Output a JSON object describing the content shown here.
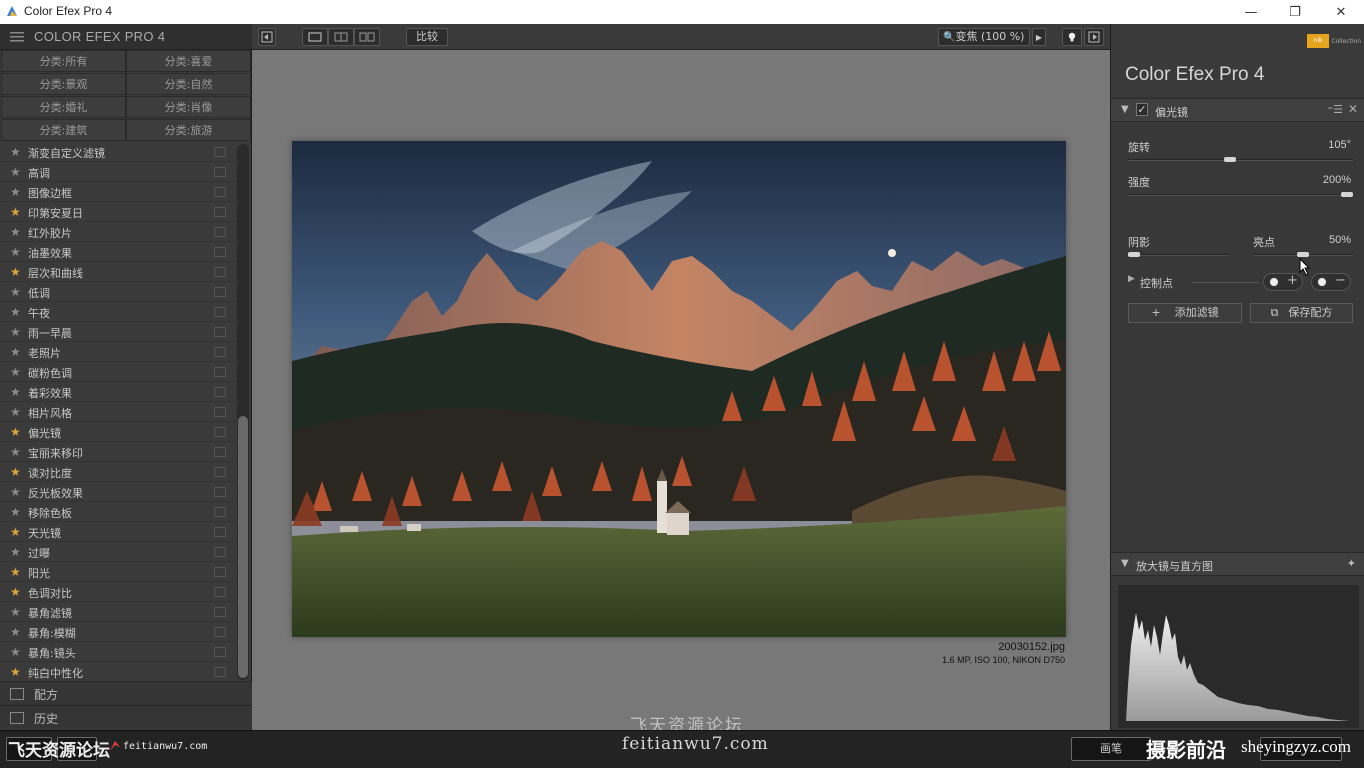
{
  "window": {
    "title": "Color Efex Pro 4",
    "minimize": "—",
    "restore": "❐",
    "close": "✕"
  },
  "left_panel": {
    "header_title": "COLOR EFEX PRO 4",
    "categories": [
      "分类:所有",
      "分类:喜爱",
      "分类:景观",
      "分类:自然",
      "分类:婚礼",
      "分类:肖像",
      "分类:建筑",
      "分类:旅游"
    ],
    "filters": [
      {
        "label": "渐变自定义滤镜",
        "fav": false
      },
      {
        "label": "高调",
        "fav": false
      },
      {
        "label": "图像边框",
        "fav": false
      },
      {
        "label": "印第安夏日",
        "fav": true
      },
      {
        "label": "红外胶片",
        "fav": false
      },
      {
        "label": "油墨效果",
        "fav": false
      },
      {
        "label": "层次和曲线",
        "fav": true
      },
      {
        "label": "低调",
        "fav": false
      },
      {
        "label": "午夜",
        "fav": false
      },
      {
        "label": "雨一早晨",
        "fav": false
      },
      {
        "label": "老照片",
        "fav": false
      },
      {
        "label": "碳粉色调",
        "fav": false
      },
      {
        "label": "着彩效果",
        "fav": false
      },
      {
        "label": "相片风格",
        "fav": false
      },
      {
        "label": "偏光镜",
        "fav": true
      },
      {
        "label": "宝丽来移印",
        "fav": false
      },
      {
        "label": "读对比度",
        "fav": true
      },
      {
        "label": "反光板效果",
        "fav": false
      },
      {
        "label": "移除色板",
        "fav": false
      },
      {
        "label": "天光镜",
        "fav": true
      },
      {
        "label": "过曝",
        "fav": false
      },
      {
        "label": "阳光",
        "fav": true
      },
      {
        "label": "色调对比",
        "fav": true
      },
      {
        "label": "暴角滤镜",
        "fav": false
      },
      {
        "label": "暴角:模糊",
        "fav": false
      },
      {
        "label": "暴角:镜头",
        "fav": false
      },
      {
        "label": "纯白中性化",
        "fav": true
      }
    ],
    "recipes_label": "配方",
    "history_label": "历史"
  },
  "toolbar": {
    "compare_label": "比较",
    "zoom_label": "变焦 (100 %)"
  },
  "image": {
    "filename": "20030152.jpg",
    "meta": "1.6 MP, ISO 100, NIKON D750"
  },
  "right_panel": {
    "brand_badge": "nik",
    "brand_sub": "Collection",
    "title": "Color Efex Pro 4",
    "filter_name": "偏光镜",
    "filter_opts": "⁼☰",
    "sliders": {
      "rotation": {
        "label": "旋转",
        "value": "105°",
        "fraction": 0.45
      },
      "strength": {
        "label": "强度",
        "value": "200%",
        "fraction": 1.0
      },
      "shadows": {
        "label": "阴影",
        "fraction": 0.0
      },
      "highlights": {
        "label": "亮点",
        "value": "50%",
        "fraction": 0.5
      }
    },
    "control_points_label": "控制点",
    "add_filter_label": "添加滤镜",
    "save_recipe_label": "保存配方",
    "loupe_label": "放大镜与直方图"
  },
  "bottom": {
    "btn_label": "画笔",
    "wm_left": "飞天资源论坛",
    "wm_left_url": "feitianwu7.com",
    "wm_center_top": "飞天资源论坛",
    "wm_center": "feitianwu7.com",
    "wm_right": "摄影前沿",
    "wm_right_url": "sheyingzyz.com"
  },
  "colors": {
    "accent_star": "#d9a23a",
    "nik_badge": "#e7a41f"
  }
}
